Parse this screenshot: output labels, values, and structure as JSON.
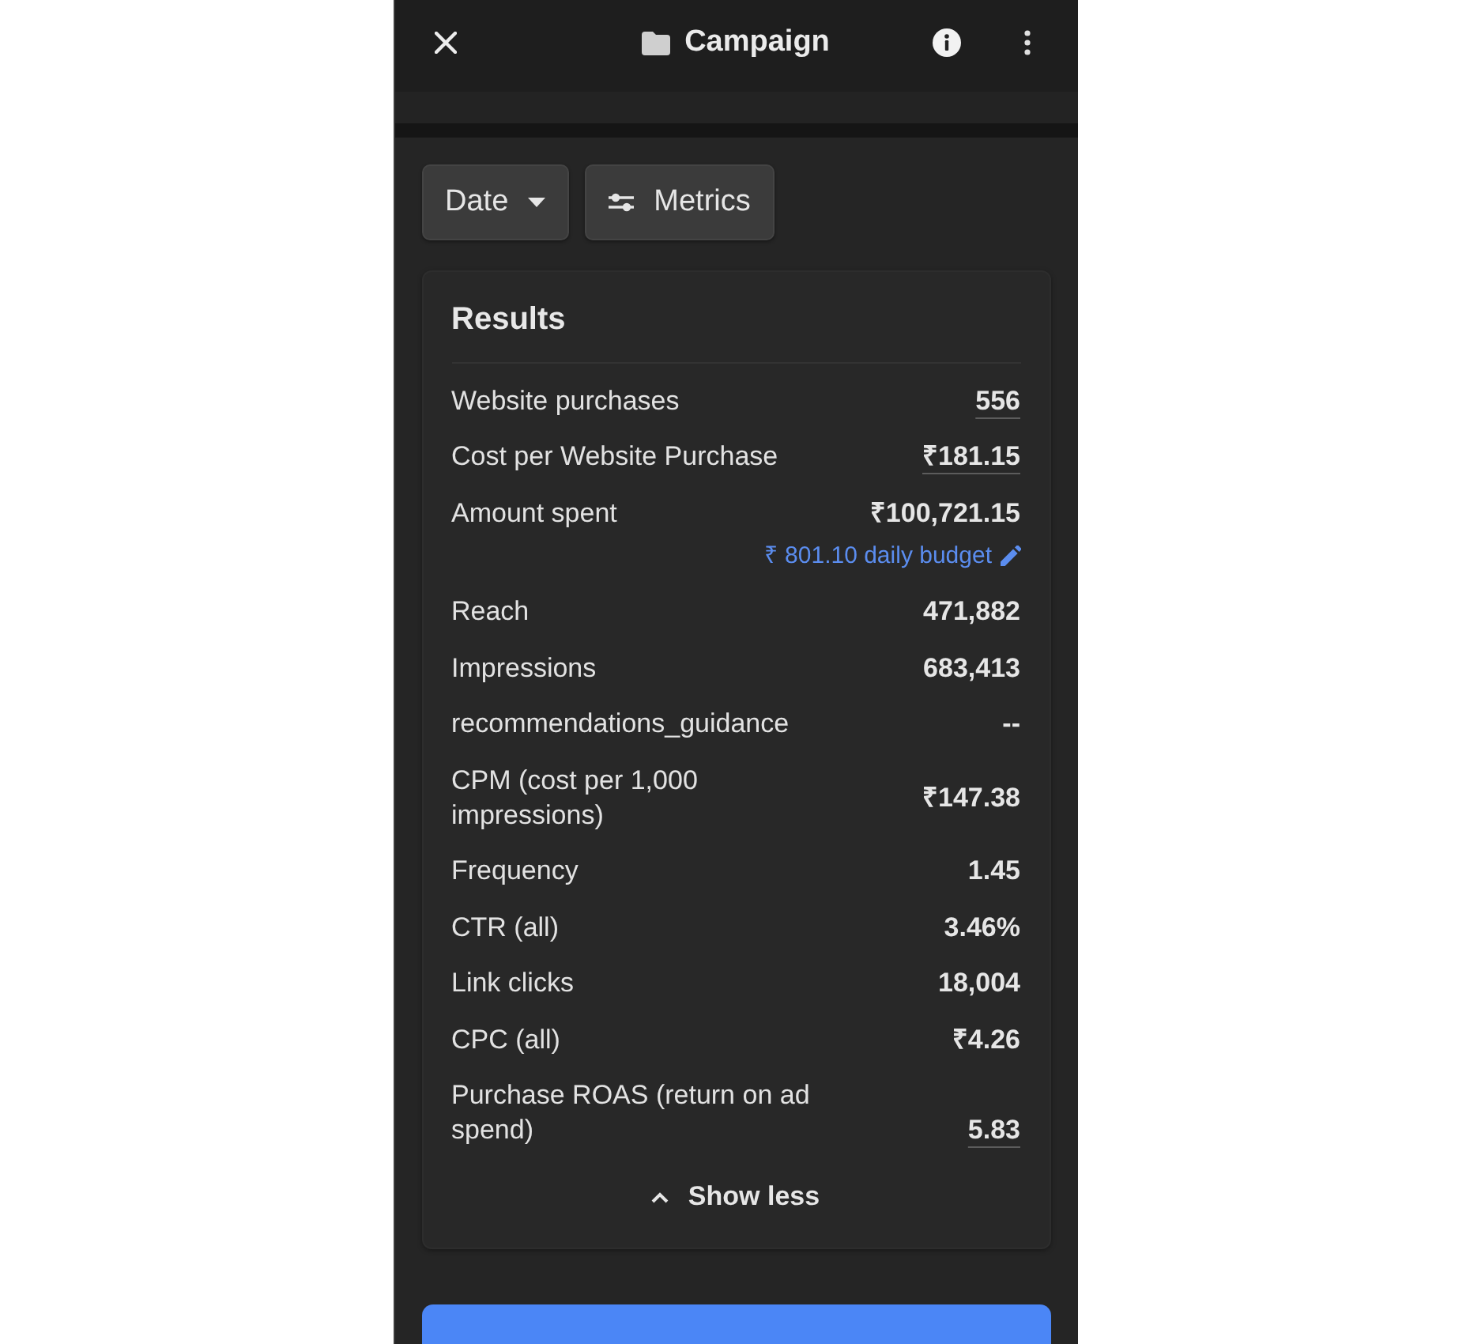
{
  "header": {
    "title": "Campaign"
  },
  "filters": [
    {
      "kind": "dropdown",
      "label": "Date"
    },
    {
      "kind": "metrics",
      "label": "Metrics"
    }
  ],
  "results": {
    "title": "Results",
    "metrics": [
      {
        "label": "Website purchases",
        "value": "556",
        "underlined": true
      },
      {
        "label": "Cost per Website Purchase",
        "value": "₹181.15",
        "underlined": true
      },
      {
        "label": "Amount spent",
        "value": "₹100,721.15",
        "underlined": false,
        "budget_link": "₹ 801.10 daily budget"
      },
      {
        "label": "Reach",
        "value": "471,882",
        "underlined": false
      },
      {
        "label": "Impressions",
        "value": "683,413",
        "underlined": false
      },
      {
        "label": "recommendations_guidance",
        "value": "--",
        "underlined": false
      },
      {
        "label": "CPM (cost per 1,000 impressions)",
        "value": "₹147.38",
        "underlined": false
      },
      {
        "label": "Frequency",
        "value": "1.45",
        "underlined": false
      },
      {
        "label": "CTR (all)",
        "value": "3.46%",
        "underlined": false
      },
      {
        "label": "Link clicks",
        "value": "18,004",
        "underlined": false
      },
      {
        "label": "CPC (all)",
        "value": "₹4.26",
        "underlined": false
      },
      {
        "label": "Purchase ROAS (return on ad spend)",
        "value": "5.83",
        "underlined": true
      }
    ],
    "toggle": {
      "label": "Show less",
      "expanded": true
    }
  }
}
